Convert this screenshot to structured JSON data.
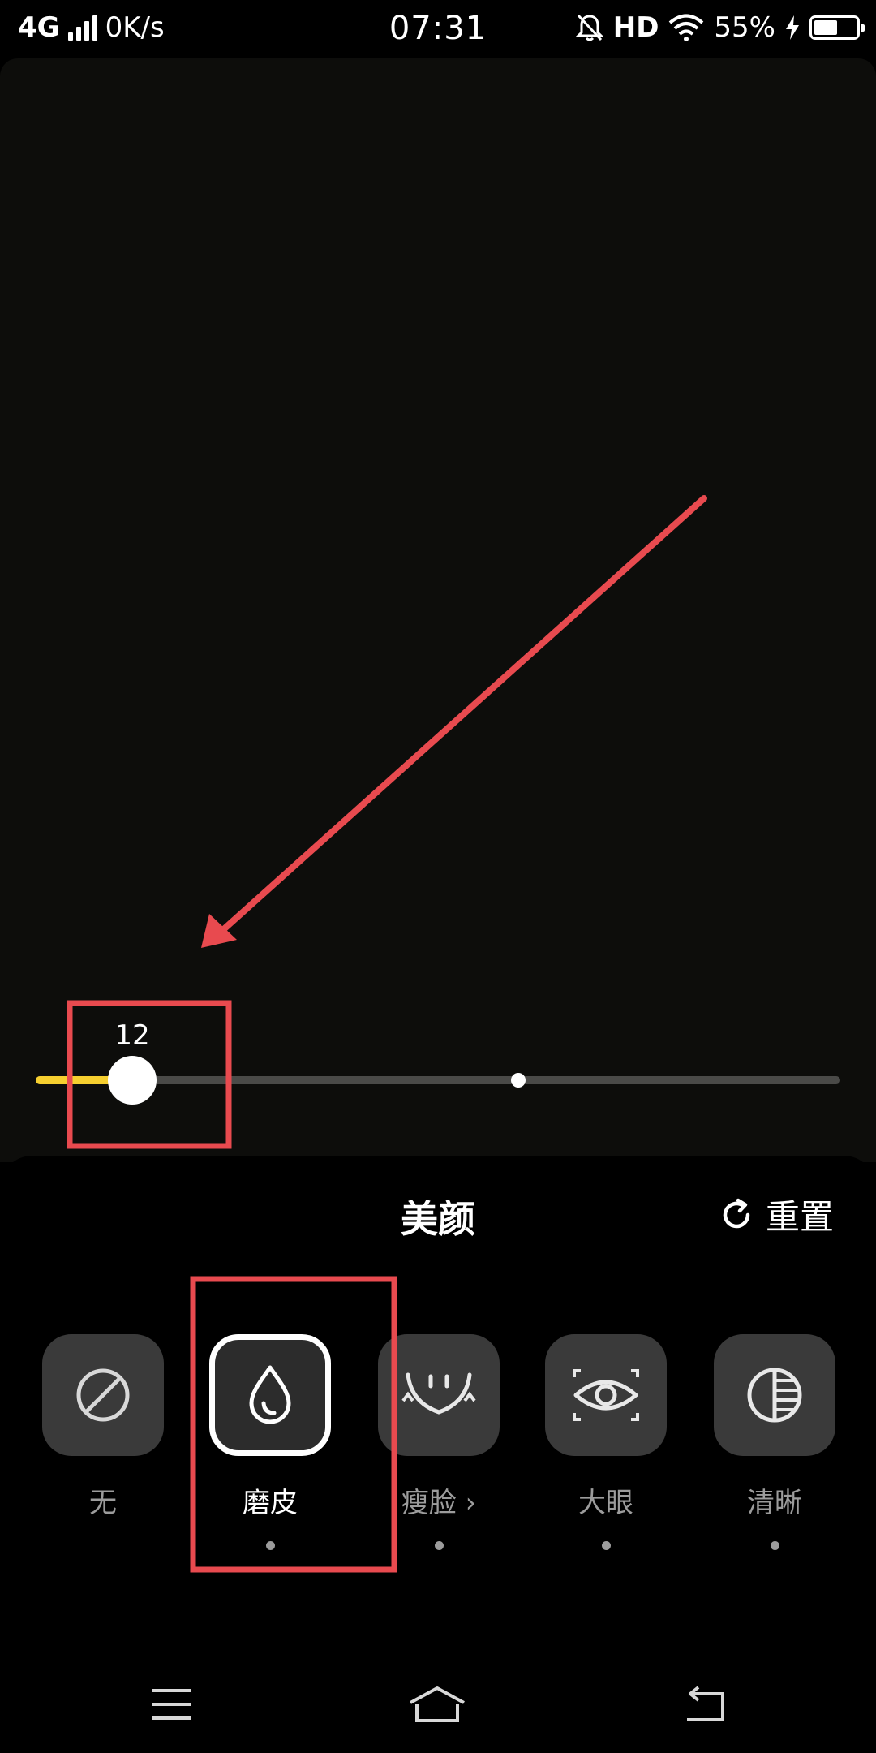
{
  "status_bar": {
    "network": "4G",
    "speed": "0K/s",
    "time": "07:31",
    "hd": "HD",
    "battery_percent": "55%",
    "battery_level": 0.55
  },
  "slider": {
    "value": "12",
    "fill_fraction": 0.12,
    "default_mark_fraction": 0.6,
    "fill_color": "#f6cf2f"
  },
  "sheet": {
    "title": "美颜",
    "reset_label": "重置"
  },
  "tools": [
    {
      "id": "none",
      "label": "无",
      "icon": "no-effect-icon",
      "selected": false,
      "has_dot": false
    },
    {
      "id": "smooth",
      "label": "磨皮",
      "icon": "water-drop-icon",
      "selected": true,
      "has_dot": true
    },
    {
      "id": "slim-face",
      "label": "瘦脸 ›",
      "icon": "face-slim-icon",
      "selected": false,
      "has_dot": true
    },
    {
      "id": "big-eye",
      "label": "大眼",
      "icon": "eye-icon",
      "selected": false,
      "has_dot": true
    },
    {
      "id": "sharpen",
      "label": "清晰",
      "icon": "sharpness-icon",
      "selected": false,
      "has_dot": true
    }
  ],
  "annotation_color": "#e84a4f"
}
